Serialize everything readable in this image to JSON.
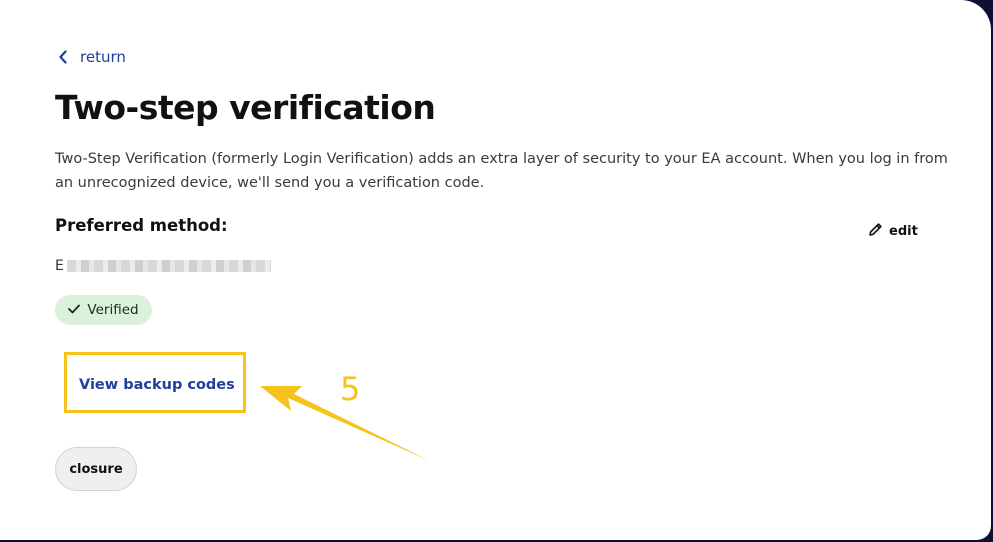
{
  "navigation": {
    "back_label": "return"
  },
  "page": {
    "title": "Two-step verification",
    "description": "Two-Step Verification (formerly Login Verification) adds an extra layer of security to your EA account. When you log in from an unrecognized device, we'll send you a verification code."
  },
  "preferred_method": {
    "label": "Preferred method:",
    "edit_label": "edit",
    "method_prefix": "E",
    "status_badge": "Verified"
  },
  "actions": {
    "view_backup_codes_label": "View backup codes",
    "close_label": "closure"
  },
  "annotation": {
    "step_number": "5",
    "color": "#f6c21c"
  },
  "colors": {
    "link": "#1f3e9e",
    "badge_background": "#dcf1d9",
    "highlight": "#f6c21c",
    "backdrop": "#0e1033"
  },
  "icons": {
    "back": "chevron-left-icon",
    "edit": "pencil-icon",
    "verified": "check-icon"
  }
}
